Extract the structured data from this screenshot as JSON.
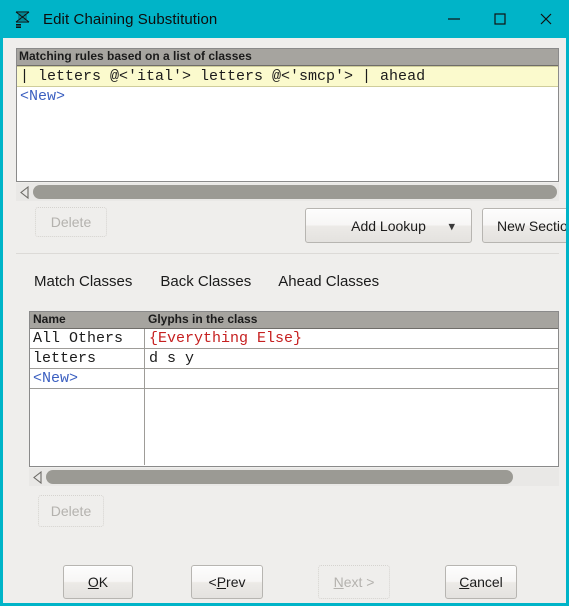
{
  "titlebar": {
    "title": "Edit Chaining Substitution",
    "icon": "fontforge-glyph-icon",
    "minimize_label": "Minimize",
    "maximize_label": "Maximize",
    "close_label": "Close",
    "background_color": "#00b4c8"
  },
  "rules_panel": {
    "header": "Matching rules based on a list of classes",
    "rows": [
      {
        "text": "| letters @<'ital'> letters @<'smcp'> | ahead",
        "selected": true
      },
      {
        "text": "<New>",
        "selected": false
      }
    ],
    "selected_color": "#fbfacd",
    "new_color": "#3b5fc0"
  },
  "rules_scrollbar": {
    "left_arrow": "scroll-left-arrow-icon",
    "thumb_start_pct": 0,
    "thumb_end_pct": 100
  },
  "rules_actions": {
    "delete_label": "Delete",
    "delete_enabled": false,
    "add_lookup_label": "Add Lookup",
    "add_lookup_chevron": "chevron-down-icon",
    "new_section_label": "New Sectio"
  },
  "tabs": {
    "items": [
      {
        "label": "Match Classes",
        "selected": true
      },
      {
        "label": "Back Classes",
        "selected": false
      },
      {
        "label": "Ahead Classes",
        "selected": false
      }
    ]
  },
  "classes_table": {
    "columns": [
      "Name",
      "Glyphs in the class"
    ],
    "rows": [
      {
        "name": "All Others",
        "glyphs": "{Everything Else}",
        "glyphs_style": "everything"
      },
      {
        "name": "letters",
        "glyphs": "d s y",
        "glyphs_style": "normal"
      },
      {
        "name": "<New>",
        "glyphs": "",
        "glyphs_style": "normal"
      }
    ],
    "everything_color": "#c62020"
  },
  "classes_scrollbar": {
    "left_arrow": "scroll-left-arrow-icon",
    "thumb_start_pct": 0,
    "thumb_end_pct": 92
  },
  "classes_actions": {
    "delete_label": "Delete",
    "delete_enabled": false
  },
  "footer": {
    "ok": {
      "prefix": "",
      "accel": "O",
      "suffix": "K",
      "enabled": true
    },
    "prev": {
      "prefix": "< ",
      "accel": "P",
      "suffix": "rev",
      "enabled": true
    },
    "next": {
      "prefix": "",
      "accel": "N",
      "suffix": "ext >",
      "enabled": false
    },
    "cancel": {
      "prefix": "",
      "accel": "C",
      "suffix": "ancel",
      "enabled": true
    }
  }
}
